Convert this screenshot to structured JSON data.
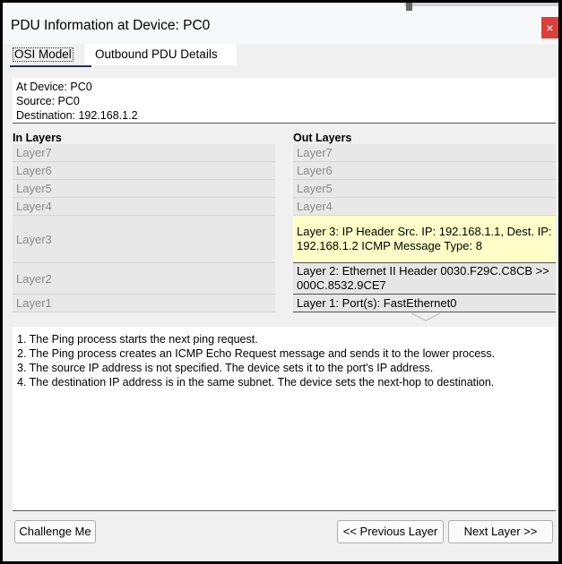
{
  "window": {
    "title": "PDU Information at Device: PC0",
    "close_glyph": "×"
  },
  "tabs": [
    {
      "label": "OSI Model",
      "active": true
    },
    {
      "label": "Outbound PDU Details",
      "active": false
    }
  ],
  "info": {
    "at_device": "At Device: PC0",
    "source": "Source: PC0",
    "destination": "Destination: 192.168.1.2"
  },
  "in_layers": {
    "heading": "In Layers",
    "items": [
      "Layer7",
      "Layer6",
      "Layer5",
      "Layer4",
      "Layer3",
      "Layer2",
      "Layer1"
    ]
  },
  "out_layers": {
    "heading": "Out Layers",
    "items": [
      "Layer7",
      "Layer6",
      "Layer5",
      "Layer4",
      "Layer 3: IP Header Src. IP: 192.168.1.1, Dest. IP: 192.168.1.2 ICMP Message Type: 8",
      "Layer 2: Ethernet II Header 0030.F29C.C8CB >> 000C.8532.9CE7",
      "Layer 1: Port(s): FastEthernet0"
    ]
  },
  "description": [
    "1. The Ping process starts the next ping request.",
    "2. The Ping process creates an ICMP Echo Request message and sends it to the lower process.",
    "3. The source IP address is not specified. The device sets it to the port's IP address.",
    "4. The destination IP address is in the same subnet. The device sets the next-hop to destination."
  ],
  "buttons": {
    "challenge": "Challenge Me",
    "previous": "<< Previous Layer",
    "next": "Next Layer >>"
  },
  "colors": {
    "close_button": "#d9413a",
    "highlight_layer": "#fffec8",
    "tab_underline": "#1f3552"
  }
}
